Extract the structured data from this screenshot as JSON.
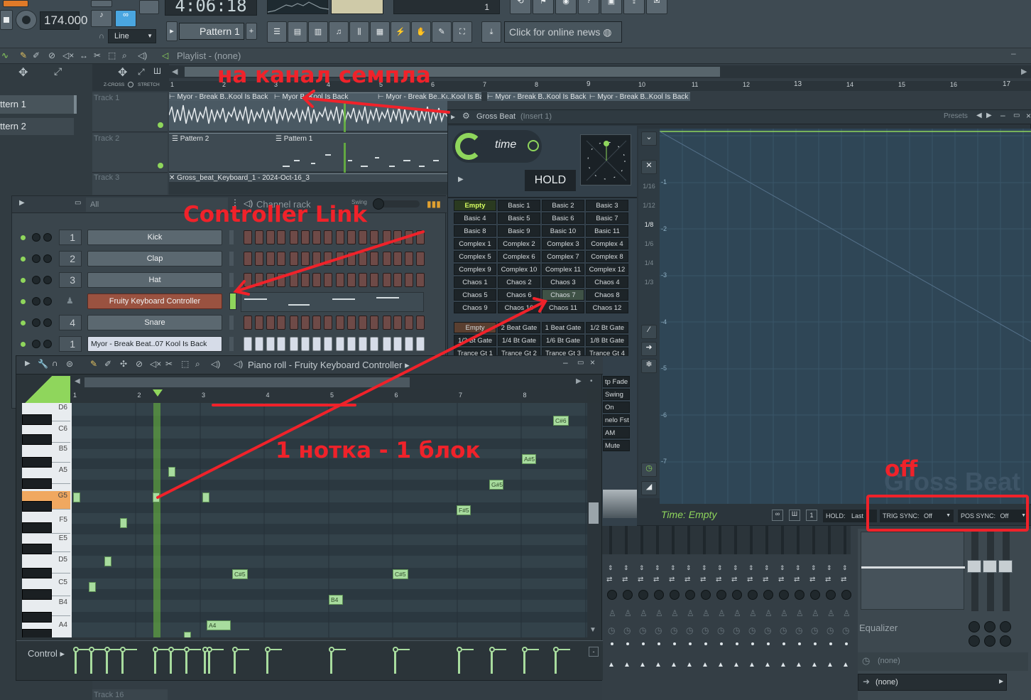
{
  "topbar": {
    "time": "4:06:18",
    "tempo": "174.000",
    "pattern": "Pattern 1",
    "snap": "Line",
    "news": "Click for online news",
    "counter_small": "1"
  },
  "playlist": {
    "title": "Playlist - (none)",
    "patterns": [
      "ttern 1",
      "ttern 2"
    ],
    "zcross": "Z-CROSS",
    "stretch": "STRETCH",
    "ruler": [
      "1",
      "2",
      "3",
      "4",
      "5",
      "6",
      "7",
      "8",
      "9",
      "10",
      "11",
      "12",
      "13",
      "14",
      "15",
      "16",
      "17"
    ],
    "tracks": [
      "Track 1",
      "Track 2",
      "Track 3",
      "Track 16"
    ],
    "audio_clips": [
      "Myor - Break B..Kool Is Back",
      "Myor",
      "B..Kool Is Back",
      "Myor - Break Be..Kool Is Back",
      "Myor - Break B..Kool Is Back",
      "Myor - Break B..Kool Is Back"
    ],
    "pattern_clips": [
      "Pattern 2",
      "Pattern 1"
    ],
    "automation_clip": "Gross_beat_Keyboard_1 - 2024-Oct-16_3"
  },
  "grossbeat": {
    "title": "Gross Beat",
    "insert": "(Insert 1)",
    "presets": "Presets",
    "mode": "time",
    "hold": "HOLD",
    "time_presets": [
      "Empty",
      "Basic 1",
      "Basic 2",
      "Basic 3",
      "Basic 4",
      "Basic 5",
      "Basic 6",
      "Basic 7",
      "Basic 8",
      "Basic 9",
      "Basic 10",
      "Basic 11",
      "Complex 1",
      "Complex 2",
      "Complex 3",
      "Complex 4",
      "Complex 5",
      "Complex 6",
      "Complex 7",
      "Complex 8",
      "Complex 9",
      "Complex 10",
      "Complex 11",
      "Complex 12",
      "Chaos 1",
      "Chaos 2",
      "Chaos 3",
      "Chaos 4",
      "Chaos 5",
      "Chaos 6",
      "Chaos 7",
      "Chaos 8",
      "Chaos 9",
      "Chaos 10",
      "Chaos 11",
      "Chaos 12"
    ],
    "volume_presets": [
      "Empty",
      "2 Beat Gate",
      "1 Beat Gate",
      "1/2 Bt Gate",
      "1/3 Bt Gate",
      "1/4 Bt Gate",
      "1/6 Bt Gate",
      "1/8 Bt Gate",
      "Trance Gt 1",
      "Trance Gt 2",
      "Trance Gt 3",
      "Trance Gt 4"
    ],
    "side_presets": [
      "tp Fade",
      "Swing",
      "On Gate",
      "nelo Fst",
      "AM",
      "Mute"
    ],
    "grid_side": [
      "1/16",
      "1/12",
      "1/8",
      "1/6",
      "1/4",
      "1/3"
    ],
    "grid_left": [
      "-1",
      "-2",
      "-3",
      "-4",
      "-5",
      "-6",
      "-7"
    ],
    "watermark": "Gross Beat",
    "status": "Time: Empty",
    "hold_label": "HOLD:",
    "hold_value": "Last",
    "trig_sync_label": "TRIG SYNC:",
    "trig_sync_value": "Off",
    "pos_sync_label": "POS SYNC:",
    "pos_sync_value": "Off",
    "counter": "1"
  },
  "channel_rack": {
    "filter": "All",
    "title": "Channel rack",
    "swing": "Swing",
    "channels": [
      {
        "num": "1",
        "name": "Kick"
      },
      {
        "num": "2",
        "name": "Clap"
      },
      {
        "num": "3",
        "name": "Hat"
      },
      {
        "num": "",
        "name": "Fruity Keyboard Controller"
      },
      {
        "num": "4",
        "name": "Snare"
      },
      {
        "num": "1",
        "name": "Myor - Break Beat..07 Kool Is Back"
      }
    ]
  },
  "piano_roll": {
    "title": "Piano roll - Fruity Keyboard Controller",
    "ruler": [
      "1",
      "2",
      "3",
      "4",
      "5",
      "6",
      "7",
      "8"
    ],
    "keys": [
      "D6",
      "C6",
      "B5",
      "A5",
      "G5",
      "F5",
      "E5",
      "D5",
      "C5",
      "B4",
      "A4"
    ],
    "note_labels": [
      "C#6",
      "A#5",
      "G#5",
      "F#5",
      "C#5",
      "C#5",
      "B4",
      "A4"
    ],
    "control_label": "Control"
  },
  "mixer": {
    "equalizer": "Equalizer",
    "slot_none_1": "(none)",
    "slot_none_2": "(none)"
  },
  "annotations": {
    "sample_channel": "на канал семпла",
    "controller_link": "Controller Link",
    "one_note_one_block": "1 нотка - 1 блок",
    "off": "off"
  },
  "colors": {
    "annotation": "#f0222a",
    "note": "#a8dc9e",
    "gb_accent": "#8fd65c",
    "step": "#6e4a47",
    "selected_channel": "#9a5240"
  }
}
